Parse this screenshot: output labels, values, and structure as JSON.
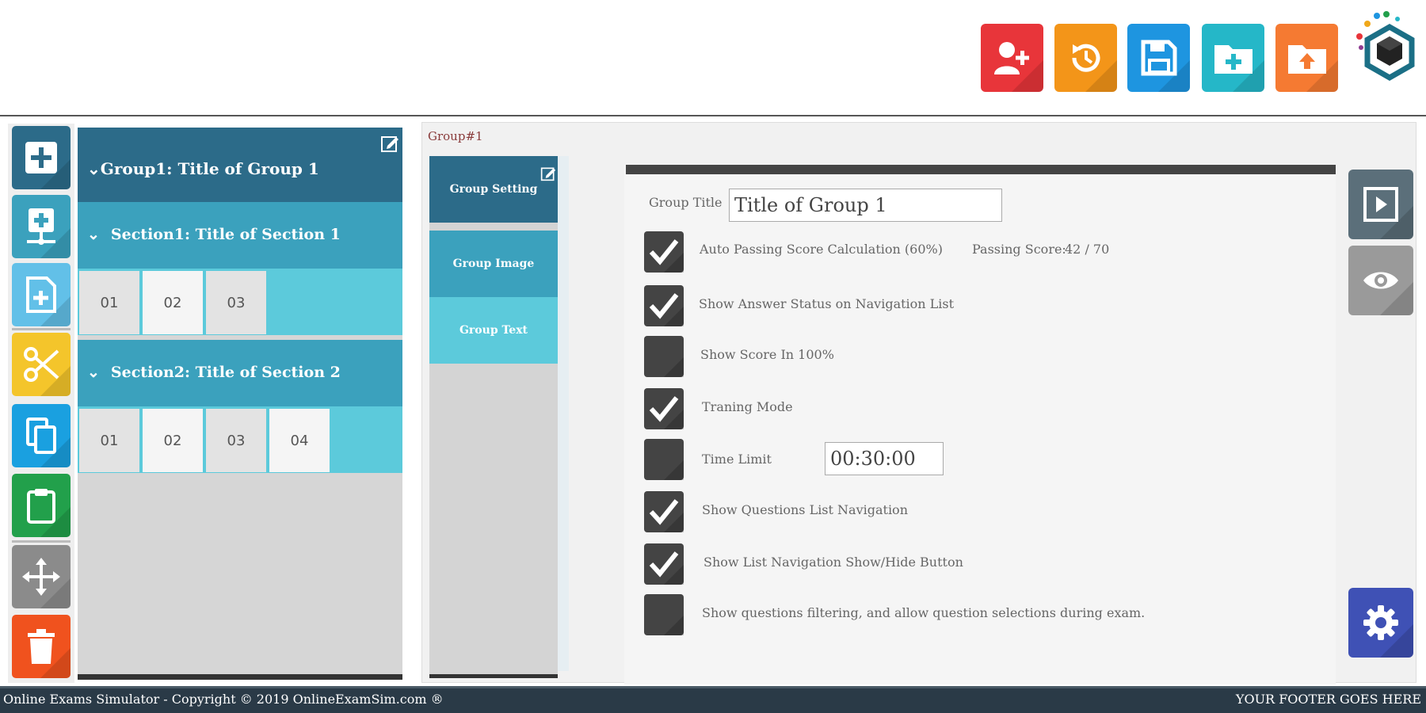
{
  "header": {
    "buttons": [
      {
        "icon": "add-user-icon",
        "color": "#e8353a"
      },
      {
        "icon": "history-icon",
        "color": "#f39519"
      },
      {
        "icon": "save-icon",
        "color": "#1e95e0"
      },
      {
        "icon": "new-folder-icon",
        "color": "#25b7c8"
      },
      {
        "icon": "upload-folder-icon",
        "color": "#f57a32"
      }
    ],
    "logo": "app-logo"
  },
  "tools": [
    {
      "icon": "plus-icon",
      "color": "#2c6b89"
    },
    {
      "icon": "add-section-icon",
      "color": "#3ba1bd"
    },
    {
      "icon": "add-question-icon",
      "color": "#62c0e8"
    },
    {
      "icon": "scissors-icon",
      "color": "#f4c52b"
    },
    {
      "icon": "copy-icon",
      "color": "#1aa0e0"
    },
    {
      "icon": "paste-icon",
      "color": "#22a04b"
    },
    {
      "icon": "move-icon",
      "color": "#8b8b8b"
    },
    {
      "icon": "trash-icon",
      "color": "#f0521e"
    }
  ],
  "tree": {
    "group_label": "Group1: Title of Group 1",
    "sections": [
      {
        "label": "Section1: Title of Section 1",
        "questions": [
          "01",
          "02",
          "03"
        ]
      },
      {
        "label": "Section2: Title of Section 2",
        "questions": [
          "01",
          "02",
          "03",
          "04"
        ]
      }
    ]
  },
  "breadcrumb": "Group#1",
  "tabs": [
    {
      "label": "Group Setting",
      "color": "#2c6b89"
    },
    {
      "label": "Group Image",
      "color": "#3ba1bd"
    },
    {
      "label": "Group Text",
      "color": "#5ccadb"
    }
  ],
  "form": {
    "group_title_label": "Group Title",
    "group_title_value": "Title of Group 1",
    "passing_score_label": "Passing Score:",
    "passing_score_value": "42 / 70",
    "time_limit_value": "00:30:00",
    "options": [
      {
        "label": "Auto Passing Score Calculation (60%)",
        "checked": true
      },
      {
        "label": "Show Answer Status on Navigation List",
        "checked": true
      },
      {
        "label": "Show Score In 100%",
        "checked": false
      },
      {
        "label": "Traning Mode",
        "checked": true
      },
      {
        "label": "Time Limit",
        "checked": false
      },
      {
        "label": "Show Questions List Navigation",
        "checked": true
      },
      {
        "label": "Show List Navigation Show/Hide Button",
        "checked": true
      },
      {
        "label": "Show questions filtering, and allow question selections during exam.",
        "checked": false
      }
    ]
  },
  "side_buttons": [
    {
      "icon": "play-icon",
      "color": "#5b6f7a"
    },
    {
      "icon": "eye-icon",
      "color": "#9a9a9a"
    },
    {
      "icon": "settings-icon",
      "color": "#3f51b5"
    }
  ],
  "footer": {
    "left": "Online Exams Simulator - Copyright © 2019 OnlineExamSim.com ®",
    "right": "YOUR FOOTER GOES HERE"
  }
}
